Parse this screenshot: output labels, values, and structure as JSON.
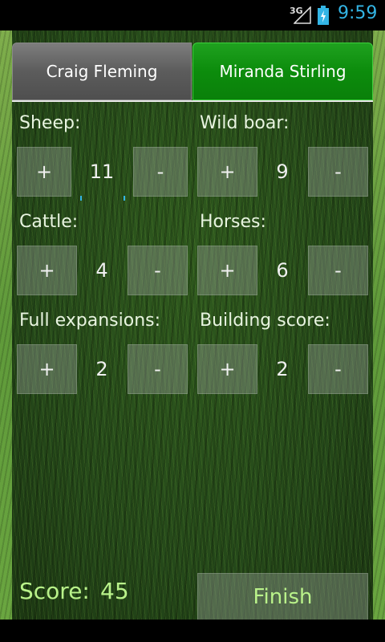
{
  "status": {
    "network": "3G",
    "time": "9:59",
    "accent_color": "#33b5e5"
  },
  "tabs": [
    {
      "label": "Craig Fleming",
      "selected": false
    },
    {
      "label": "Miranda Stirling",
      "selected": true
    }
  ],
  "left": {
    "fields": [
      {
        "label": "Sheep:",
        "value": "11",
        "plus": "+",
        "minus": "-"
      },
      {
        "label": "Cattle:",
        "value": "4",
        "plus": "+",
        "minus": "-"
      },
      {
        "label": "Full expansions:",
        "value": "2",
        "plus": "+",
        "minus": "-"
      }
    ],
    "score_label": "Score:",
    "score_value": "45"
  },
  "right": {
    "fields": [
      {
        "label": "Wild boar:",
        "value": "9",
        "plus": "+",
        "minus": "-"
      },
      {
        "label": "Horses:",
        "value": "6",
        "plus": "+",
        "minus": "-"
      },
      {
        "label": "Building score:",
        "value": "2",
        "plus": "+",
        "minus": "-"
      }
    ],
    "finish_label": "Finish"
  },
  "colors": {
    "selected_tab": "#0c8c0c",
    "unselected_tab": "#5c5c5c",
    "score_text": "#b9f28a"
  }
}
